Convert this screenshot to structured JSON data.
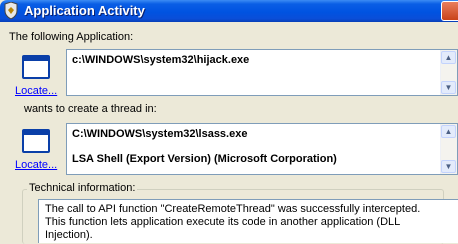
{
  "window": {
    "title": "Application Activity"
  },
  "source": {
    "label": "The following Application:",
    "locate_link": "Locate...",
    "path": "c:\\WINDOWS\\system32\\hijack.exe"
  },
  "connector": {
    "label": "wants to create a thread in:"
  },
  "target": {
    "locate_link": "Locate...",
    "path": "C:\\WINDOWS\\system32\\lsass.exe",
    "description": "LSA Shell (Export Version) (Microsoft Corporation)"
  },
  "technical": {
    "label": "Technical information:",
    "line1": "The call to API function \"CreateRemoteThread\" was successfully intercepted.",
    "line2": "This function lets application execute its code in another application (DLL",
    "line3": "Injection)."
  },
  "colors": {
    "titlebar": "#0053e1",
    "link": "#0000ff",
    "background": "#ece9d8"
  }
}
